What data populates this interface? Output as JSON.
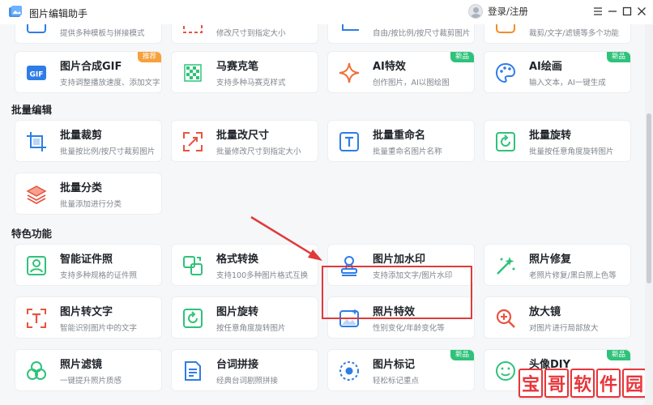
{
  "app": {
    "title": "图片编辑助手",
    "login": "登录/注册"
  },
  "colors": {
    "accent_green": "#2fc27a",
    "badge_orange": "#f6a13c",
    "highlight_red": "#e03a3a"
  },
  "top_cards": [
    {
      "desc": "提供多种模板与拼接模式"
    },
    {
      "desc": "修改尺寸到指定大小"
    },
    {
      "desc": "自由/按比例/按尺寸裁剪图片"
    },
    {
      "desc": "裁剪/文字/滤镜等多个功能"
    }
  ],
  "row1": [
    {
      "title": "图片合成GIF",
      "desc": "支持调整播放速度、添加文字",
      "icon": "gif-icon",
      "badge": "推荐"
    },
    {
      "title": "马赛克笔",
      "desc": "支持多种马赛克样式",
      "icon": "mosaic-icon"
    },
    {
      "title": "AI特效",
      "desc": "创作图片，AI以图绘图",
      "icon": "sparkle-icon",
      "badge": "新品"
    },
    {
      "title": "AI绘画",
      "desc": "输入文本，AI一键生成",
      "icon": "palette-icon",
      "badge": "新品"
    }
  ],
  "sections": {
    "batch": "批量编辑",
    "special": "特色功能"
  },
  "batch": [
    {
      "title": "批量裁剪",
      "desc": "批量按比例/按尺寸裁剪图片",
      "icon": "crop-icon"
    },
    {
      "title": "批量改尺寸",
      "desc": "批量修改尺寸到指定大小",
      "icon": "resize-icon"
    },
    {
      "title": "批量重命名",
      "desc": "批量重命名图片名称",
      "icon": "rename-icon"
    },
    {
      "title": "批量旋转",
      "desc": "批量按任意角度旋转图片",
      "icon": "rotate-icon"
    },
    {
      "title": "批量分类",
      "desc": "批量添加进行分类",
      "icon": "layers-icon"
    }
  ],
  "special": [
    {
      "title": "智能证件照",
      "desc": "支持多种规格的证件照",
      "icon": "id-photo-icon"
    },
    {
      "title": "格式转换",
      "desc": "支持100多种图片格式互换",
      "icon": "convert-icon"
    },
    {
      "title": "图片加水印",
      "desc": "支持添加文字/图片水印",
      "icon": "stamp-icon"
    },
    {
      "title": "照片修复",
      "desc": "老照片修复/黑白照上色等",
      "icon": "magic-wand-icon"
    },
    {
      "title": "图片转文字",
      "desc": "智能识别图片中的文字",
      "icon": "ocr-icon"
    },
    {
      "title": "图片旋转",
      "desc": "按任意角度旋转图片",
      "icon": "rotate-icon"
    },
    {
      "title": "照片特效",
      "desc": "性别变化/年龄变化等",
      "icon": "effect-icon"
    },
    {
      "title": "放大镜",
      "desc": "对图片进行局部放大",
      "icon": "magnifier-icon"
    },
    {
      "title": "照片滤镜",
      "desc": "一键提升照片质感",
      "icon": "filter-icon"
    },
    {
      "title": "台词拼接",
      "desc": "经典台词剧照拼接",
      "icon": "subtitle-icon"
    },
    {
      "title": "图片标记",
      "desc": "轻松标记重点",
      "icon": "mark-icon",
      "badge": "新品"
    },
    {
      "title": "头像DIY",
      "desc": "",
      "icon": "face-icon",
      "badge": "新品"
    }
  ],
  "watermark": [
    "宝",
    "哥",
    "软",
    "件",
    "园"
  ]
}
